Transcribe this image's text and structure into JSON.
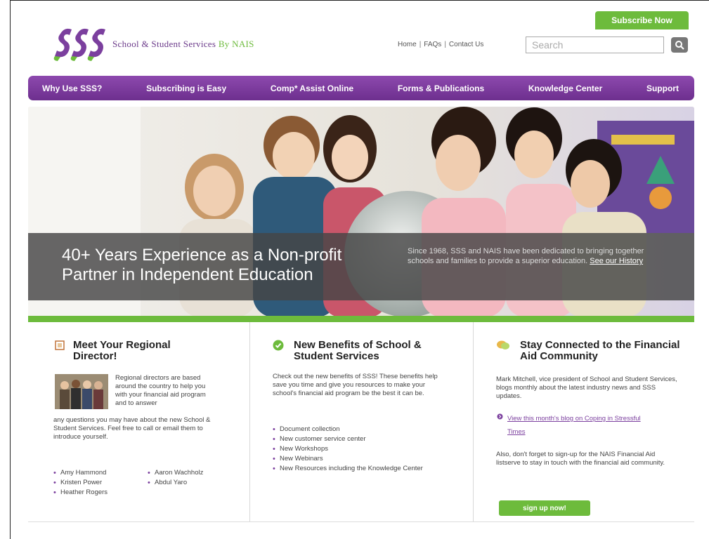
{
  "header": {
    "subscribe_label": "Subscribe Now",
    "logo_text_main": "School & Student Services",
    "logo_text_by": "By NAIS",
    "top_links": [
      "Home",
      "FAQs",
      "Contact Us"
    ],
    "search_placeholder": "Search"
  },
  "nav": {
    "items": [
      "Why Use SSS?",
      "Subscribing is Easy",
      "Comp* Assist Online",
      "Forms & Publications",
      "Knowledge Center",
      "Support"
    ]
  },
  "hero": {
    "headline": "40+ Years Experience as a Non-profit Partner in Independent Education",
    "sub_text": "Since 1968, SSS and NAIS have been dedicated to bringing together schools and families to provide a superior education.",
    "sub_link": "See our History"
  },
  "col1": {
    "title": "Meet Your Regional Director!",
    "text_right": "Regional directors are based around the country to help you with your financial aid program and to answer",
    "text_full": "any questions you may have about the new School & Student Services. Feel free to call or email them to introduce yourself.",
    "directors_left": [
      "Amy Hammond",
      "Kristen Power",
      "Heather Rogers"
    ],
    "directors_right": [
      "Aaron Wachholz",
      "Abdul Yaro"
    ]
  },
  "col2": {
    "title": "New Benefits of School & Student Services",
    "intro": "Check out the new benefits of SSS! These benefits help save you time and give you resources to make your school's financial aid program be the best it can be.",
    "benefits": [
      "Document collection",
      "New customer service center",
      "New Workshops",
      "New Webinars",
      "New Resources including the Knowledge Center"
    ]
  },
  "col3": {
    "title": "Stay Connected to the Financial Aid Community",
    "intro": "Mark Mitchell, vice president of School and Student Services, blogs monthly about the latest industry news and SSS updates.",
    "blog_link": "View this month's blog on Coping in Stressful Times",
    "outro": "Also, don't forget to sign-up for the NAIS Financial Aid listserve to stay in touch with the financial aid community.",
    "signup_label": "sign up now!"
  },
  "colors": {
    "purple": "#7b3f9e",
    "green": "#6dbb3c"
  }
}
